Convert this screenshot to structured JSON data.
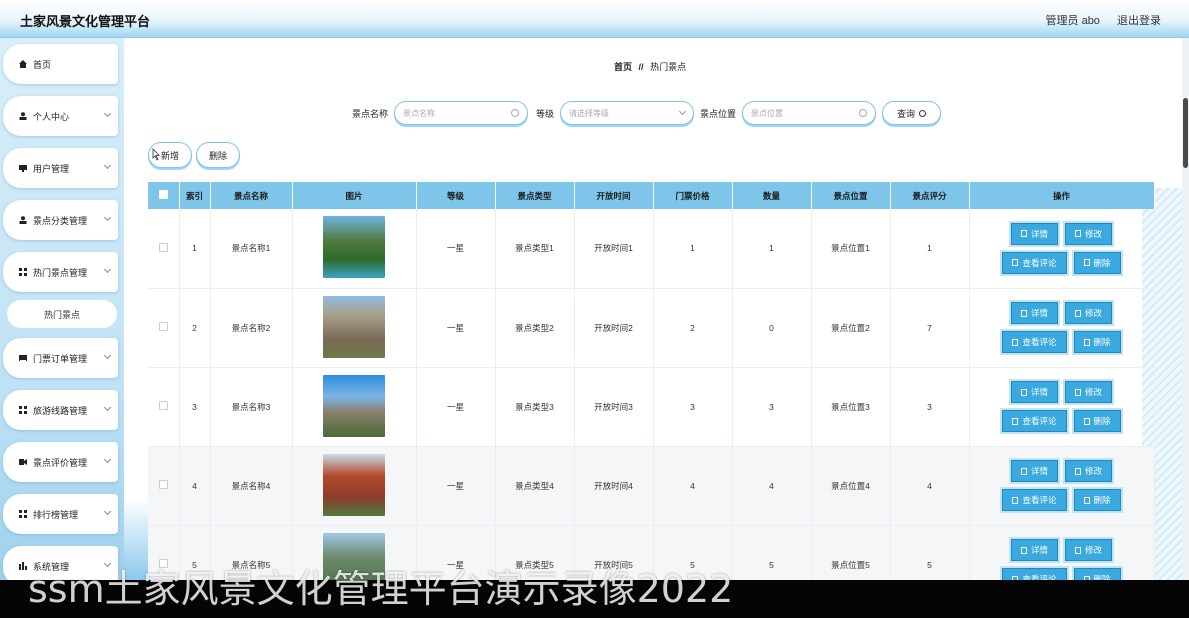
{
  "header": {
    "title": "土家风景文化管理平台",
    "user": "管理员 abo",
    "logout": "退出登录"
  },
  "sidebar": {
    "items": [
      {
        "label": "首页",
        "icon": "home-icon",
        "has_children": false
      },
      {
        "label": "个人中心",
        "icon": "user-icon",
        "has_children": true
      },
      {
        "label": "用户管理",
        "icon": "monitor-icon",
        "has_children": true
      },
      {
        "label": "景点分类管理",
        "icon": "user-icon",
        "has_children": true
      },
      {
        "label": "热门景点管理",
        "icon": "grid-icon",
        "has_children": true
      },
      {
        "label": "门票订单管理",
        "icon": "ticket-icon",
        "has_children": true
      },
      {
        "label": "旅游线路管理",
        "icon": "grid-icon",
        "has_children": true
      },
      {
        "label": "景点评价管理",
        "icon": "video-icon",
        "has_children": true
      },
      {
        "label": "排行榜管理",
        "icon": "grid-icon",
        "has_children": true
      },
      {
        "label": "系统管理",
        "icon": "chart-icon",
        "has_children": true
      }
    ],
    "sub_item": "热门景点"
  },
  "breadcrumb": {
    "home": "首页",
    "separator": "//",
    "current": "热门景点"
  },
  "search": {
    "name_label": "景点名称",
    "name_placeholder": "景点名称",
    "level_label": "等级",
    "level_placeholder": "请选择等级",
    "location_label": "景点位置",
    "location_placeholder": "景点位置",
    "query_button": "查询"
  },
  "actions": {
    "add": "新增",
    "delete": "删除"
  },
  "table": {
    "columns": [
      "索引",
      "景点名称",
      "图片",
      "等级",
      "景点类型",
      "开放时间",
      "门票价格",
      "数量",
      "景点位置",
      "景点评分",
      "操作"
    ],
    "rows": [
      {
        "index": "1",
        "name": "景点名称1",
        "level": "一星",
        "type": "景点类型1",
        "open": "开放时间1",
        "price": "1",
        "qty": "1",
        "location": "景点位置1",
        "score": "1"
      },
      {
        "index": "2",
        "name": "景点名称2",
        "level": "一星",
        "type": "景点类型2",
        "open": "开放时间2",
        "price": "2",
        "qty": "0",
        "location": "景点位置2",
        "score": "7"
      },
      {
        "index": "3",
        "name": "景点名称3",
        "level": "一星",
        "type": "景点类型3",
        "open": "开放时间3",
        "price": "3",
        "qty": "3",
        "location": "景点位置3",
        "score": "3"
      },
      {
        "index": "4",
        "name": "景点名称4",
        "level": "一星",
        "type": "景点类型4",
        "open": "开放时间4",
        "price": "4",
        "qty": "4",
        "location": "景点位置4",
        "score": "4"
      },
      {
        "index": "5",
        "name": "景点名称5",
        "level": "一星",
        "type": "景点类型5",
        "open": "开放时间5",
        "price": "5",
        "qty": "5",
        "location": "景点位置5",
        "score": "5"
      }
    ],
    "op_buttons": {
      "detail": "详情",
      "edit": "修改",
      "review": "查看评论",
      "delete": "删除"
    }
  },
  "overlay": {
    "caption": "ssm土家风景文化管理平台演示录像2022"
  },
  "colors": {
    "accent": "#39a9e0",
    "table_header": "#7dc6ea",
    "border": "#7fc3ea"
  }
}
